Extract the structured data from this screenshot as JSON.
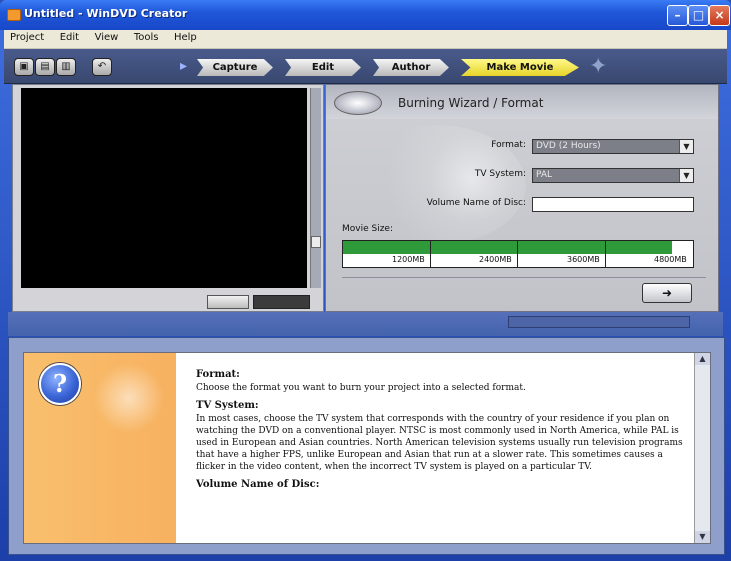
{
  "window": {
    "title": "Untitled - WinDVD Creator"
  },
  "menu": [
    "Project",
    "Edit",
    "View",
    "Tools",
    "Help"
  ],
  "toolbar": {
    "icons": [
      "new-project-icon",
      "open-project-icon",
      "save-project-icon",
      "undo-icon"
    ],
    "steps": [
      "Capture",
      "Edit",
      "Author",
      "Make Movie"
    ]
  },
  "wizard": {
    "title": "Burning Wizard / Format",
    "format_label": "Format:",
    "format_value": "DVD (2 Hours)",
    "tv_label": "TV System:",
    "tv_value": "PAL",
    "volume_label": "Volume Name of Disc:",
    "volume_value": "",
    "movie_size_label": "Movie Size:",
    "size_ticks": [
      "1200MB",
      "2400MB",
      "3600MB",
      "4800MB"
    ],
    "size_fraction": 0.94,
    "next_label": "➜"
  },
  "help": {
    "sections": [
      {
        "heading": "Format:",
        "body": "Choose the format you want to burn your project into a selected format."
      },
      {
        "heading": "TV System:",
        "body": "In most cases, choose the TV system that corresponds with the country of your residence if you plan on watching the DVD on a conventional player. NTSC is most commonly used in North America, while PAL is used in European and Asian countries. North American television systems usually run television programs that have a higher FPS, unlike European and Asian that run at a slower rate. This sometimes causes a flicker in the video content, when the incorrect TV system is played on a particular TV."
      },
      {
        "heading": "Volume Name of Disc:",
        "body": ""
      }
    ]
  },
  "colors": {
    "accent": "#2e9a3a",
    "make_movie": "#fff98a",
    "help_side": "#f7b160"
  }
}
